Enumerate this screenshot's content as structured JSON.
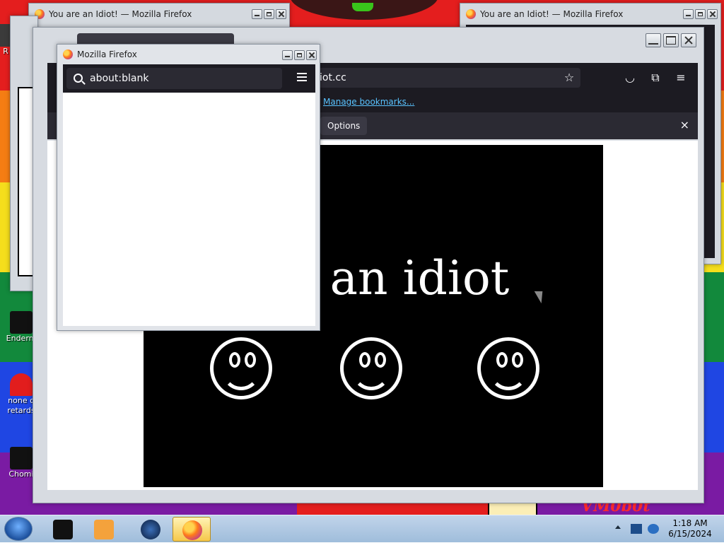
{
  "desktop": {
    "icons": [
      {
        "label": "R"
      },
      {
        "label": "Enderm"
      },
      {
        "label": "none o\nretards"
      },
      {
        "label": "Chomi"
      }
    ]
  },
  "background_windows": [
    {
      "title": "You are an Idiot! — Mozilla Firefox"
    },
    {
      "title": "You are an Idiot! — Mozilla Firefox"
    }
  ],
  "main_window": {
    "url_text": "iot.cc",
    "bookmarks_link": "Manage bookmarks...",
    "options_button": "Options",
    "close_glyph": "×",
    "page_text": "are an idiot",
    "smiley_count": 3
  },
  "popup_window": {
    "title": "Mozilla Firefox",
    "url": "about:blank"
  },
  "taskbar": {
    "clock_time": "1:18 AM",
    "clock_date": "6/15/2024",
    "apps": [
      "command-prompt",
      "media-player",
      "globe",
      "firefox"
    ]
  },
  "wallpaper": {
    "watermark": "VM0b0t"
  },
  "colors": {
    "firefox_toolbar": "#1c1b22",
    "link": "#59c3ff",
    "taskbar": "#b1c9e4"
  }
}
